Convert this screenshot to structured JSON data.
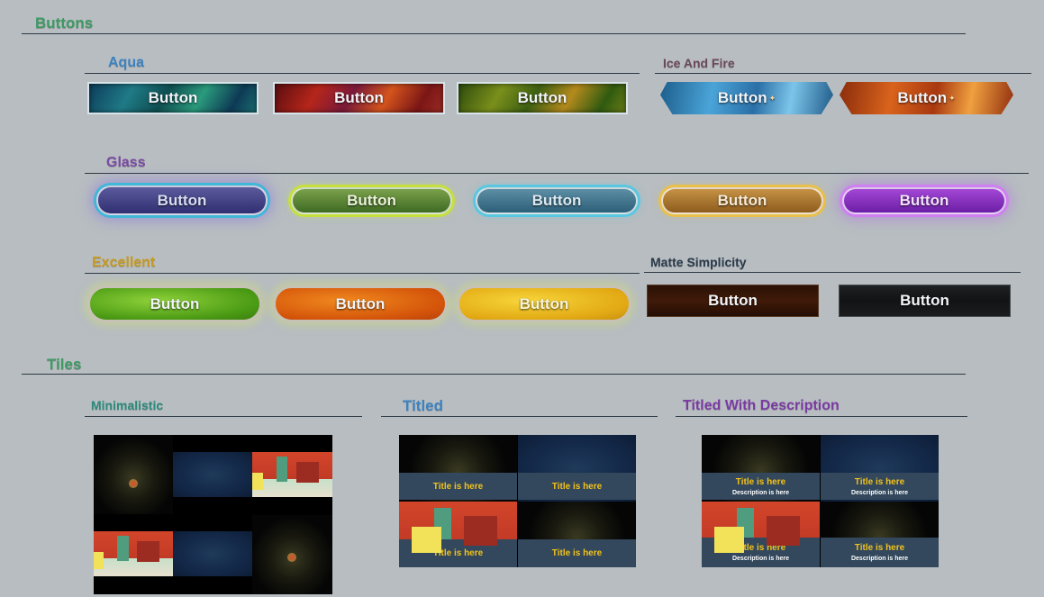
{
  "sections": {
    "buttons": "Buttons",
    "tiles": "Tiles"
  },
  "groups": {
    "aqua": "Aqua",
    "ice_and_fire": "Ice And Fire",
    "glass": "Glass",
    "excellent": "Excellent",
    "matte_simplicity": "Matte Simplicity",
    "minimalistic": "Minimalistic",
    "titled": "Titled",
    "titled_with_description": "Titled With Description"
  },
  "colors": {
    "section": "#3f9a63",
    "aqua": "#3d82bf",
    "ice_and_fire": "#6b4a5a",
    "glass": "#7b4aa3",
    "excellent": "#c79a1f",
    "matte": "#2a3a4a",
    "minimalistic": "#2c8a7a",
    "titled": "#3d82bf",
    "titled_with_description": "#7b3aa3",
    "tile_title": "#f2c21a"
  },
  "button_label": "Button",
  "tile_title": "Title is here",
  "tile_description": "Description is here"
}
